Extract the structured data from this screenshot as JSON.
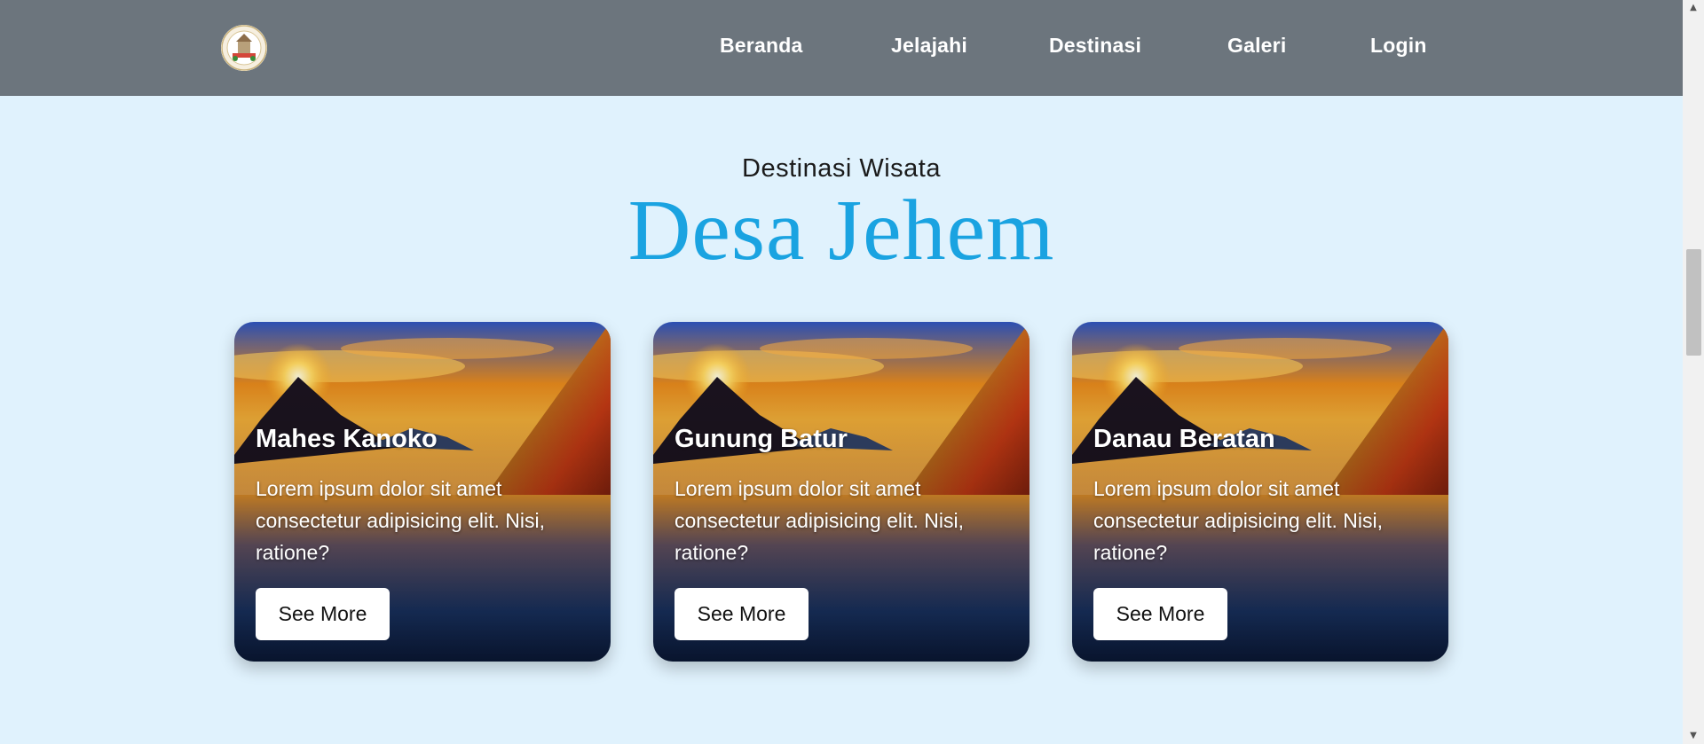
{
  "nav": {
    "logo_icon": "village-emblem-logo",
    "links": [
      "Beranda",
      "Jelajahi",
      "Destinasi",
      "Galeri",
      "Login"
    ]
  },
  "hero": {
    "subtitle": "Destinasi Wisata",
    "title": "Desa Jehem"
  },
  "cards": [
    {
      "title": "Mahes Kanoko",
      "description": "Lorem ipsum dolor sit amet consectetur adipisicing elit. Nisi, ratione?",
      "button": "See More"
    },
    {
      "title": "Gunung Batur",
      "description": "Lorem ipsum dolor sit amet consectetur adipisicing elit. Nisi, ratione?",
      "button": "See More"
    },
    {
      "title": "Danau Beratan",
      "description": "Lorem ipsum dolor sit amet consectetur adipisicing elit. Nisi, ratione?",
      "button": "See More"
    }
  ],
  "colors": {
    "navbar": "#6c757d",
    "background": "#e0f2fd",
    "title_accent": "#1aa3e1"
  }
}
